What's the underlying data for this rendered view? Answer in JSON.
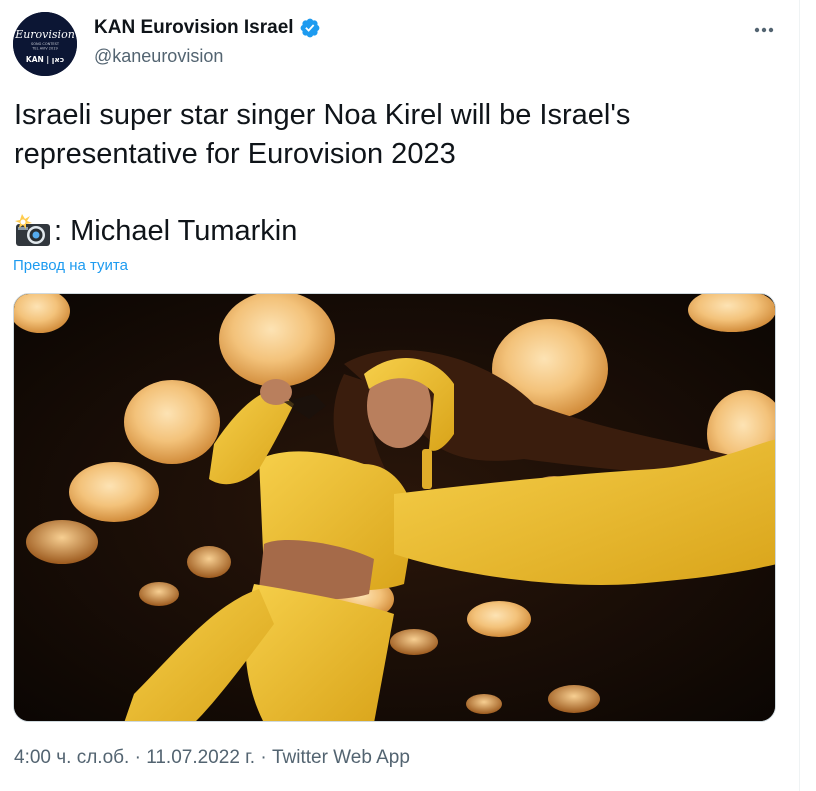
{
  "tweet": {
    "author": {
      "display_name": "KAN Eurovision Israel",
      "handle": "@kaneurovision",
      "verified": true,
      "avatar": {
        "logo_text": "Eurovision",
        "sub_text_1": "SONG CONTEST",
        "sub_text_2": "TEL AVIV 2019",
        "brand_text": "KAN | כאן"
      }
    },
    "text": "Israeli super star singer Noa Kirel will be Israel's\nrepresentative for Eurovision 2023",
    "credit": ": Michael Tumarkin",
    "credit_icon": "camera-flash-icon",
    "translate_label": "Превод на туита",
    "media": {
      "type": "photo",
      "colors": {
        "background": "#120a04",
        "outfit": "#f2c232",
        "lamp": "#f3c27a"
      }
    },
    "meta": {
      "time": "4:00 ч. сл.об.",
      "separator_1": " · ",
      "date": "11.07.2022 г.",
      "separator_2": " · ",
      "app": "Twitter Web App"
    }
  },
  "colors": {
    "text_primary": "#0f1419",
    "text_secondary": "#536471",
    "link": "#1d9bf0",
    "verified": "#1d9bf0"
  }
}
